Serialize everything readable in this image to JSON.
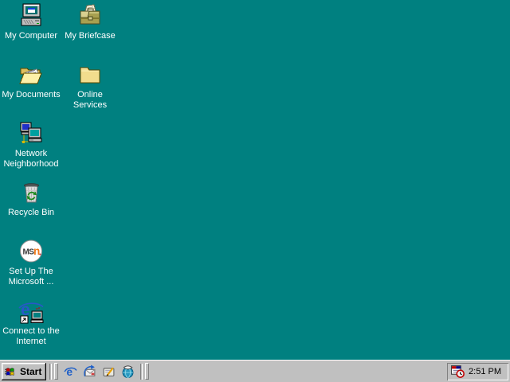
{
  "desktop": {
    "background_color": "#008080",
    "icons": [
      {
        "name": "my-computer",
        "label": "My Computer"
      },
      {
        "name": "my-briefcase",
        "label": "My Briefcase"
      },
      {
        "name": "my-documents",
        "label": "My Documents"
      },
      {
        "name": "online-services",
        "label": "Online\nServices"
      },
      {
        "name": "network-neighborhood",
        "label": "Network\nNeighborhood"
      },
      {
        "name": "recycle-bin",
        "label": "Recycle Bin"
      },
      {
        "name": "setup-msn",
        "label": "Set Up The\nMicrosoft ..."
      },
      {
        "name": "connect-internet",
        "label": "Connect to the\nInternet"
      }
    ]
  },
  "taskbar": {
    "start": {
      "label": "Start"
    },
    "quick_launch": [
      {
        "name": "internet-explorer-icon"
      },
      {
        "name": "outlook-express-icon"
      },
      {
        "name": "show-desktop-icon"
      },
      {
        "name": "view-channels-icon"
      }
    ],
    "tray": {
      "scheduler_icon": "task-scheduler-icon",
      "clock": "2:51 PM"
    }
  },
  "colors": {
    "desktop_teal": "#008080",
    "taskbar_gray": "#c0c0c0",
    "label_text": "#ffffff",
    "msn_orange": "#f07818",
    "ie_blue": "#2858c8"
  }
}
